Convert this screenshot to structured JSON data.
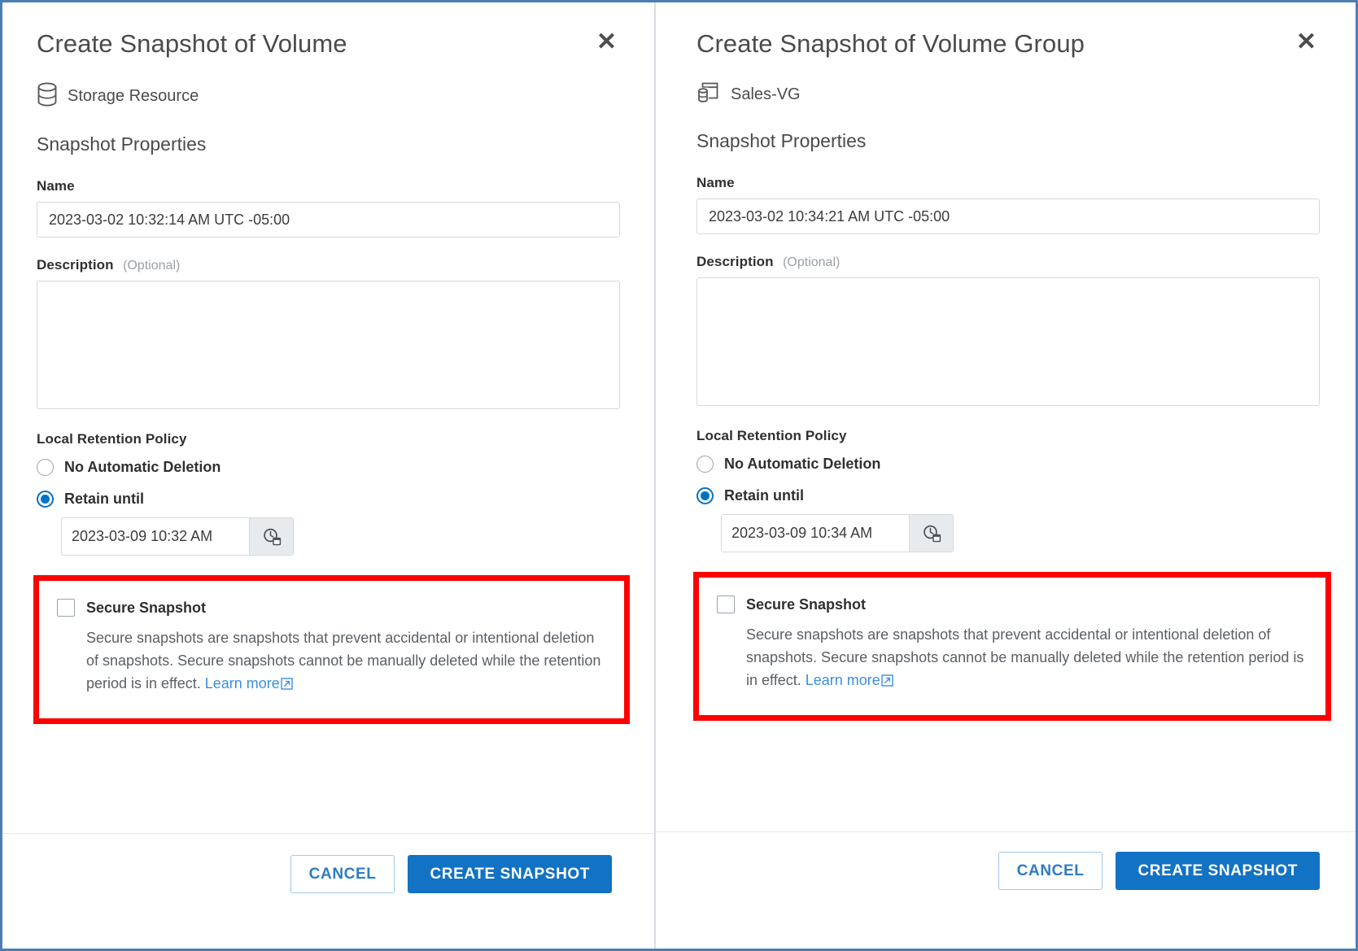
{
  "panels": [
    {
      "title": "Create Snapshot of Volume",
      "close_icon": "close-icon",
      "resource": {
        "icon": "storage-volume-icon",
        "name": "Storage Resource"
      },
      "section_title": "Snapshot Properties",
      "name_field": {
        "label": "Name",
        "value": "2023-03-02 10:32:14 AM UTC -05:00"
      },
      "description_field": {
        "label": "Description",
        "optional": "(Optional)",
        "value": "",
        "placeholder": ""
      },
      "retention": {
        "label": "Local Retention Policy",
        "options": [
          {
            "label": "No Automatic Deletion",
            "selected": false
          },
          {
            "label": "Retain until",
            "selected": true
          }
        ],
        "retain_until_value": "2023-03-09 10:32 AM",
        "picker_icon": "clock-calendar-picker-icon"
      },
      "secure_snapshot": {
        "checkbox_label": "Secure Snapshot",
        "checked": false,
        "help_text": "Secure snapshots are snapshots that prevent accidental or intentional deletion of snapshots. Secure snapshots cannot be manually deleted while the retention period is in effect. ",
        "link_text": "Learn more",
        "link_icon": "external-link-icon",
        "highlight_color": "#fe0000"
      },
      "footer": {
        "cancel_label": "CANCEL",
        "submit_label": "CREATE SNAPSHOT"
      }
    },
    {
      "title": "Create Snapshot of Volume Group",
      "close_icon": "close-icon",
      "resource": {
        "icon": "volume-group-icon",
        "name": "Sales-VG"
      },
      "section_title": "Snapshot Properties",
      "name_field": {
        "label": "Name",
        "value": "2023-03-02 10:34:21 AM UTC -05:00"
      },
      "description_field": {
        "label": "Description",
        "optional": "(Optional)",
        "value": "",
        "placeholder": ""
      },
      "retention": {
        "label": "Local Retention Policy",
        "options": [
          {
            "label": "No Automatic Deletion",
            "selected": false
          },
          {
            "label": "Retain until",
            "selected": true
          }
        ],
        "retain_until_value": "2023-03-09 10:34 AM",
        "picker_icon": "clock-calendar-picker-icon"
      },
      "secure_snapshot": {
        "checkbox_label": "Secure Snapshot",
        "checked": false,
        "help_text": "Secure snapshots are snapshots that prevent accidental or intentional deletion of snapshots. Secure snapshots cannot be manually deleted while the retention period is in effect. ",
        "link_text": "Learn more",
        "link_icon": "external-link-icon",
        "highlight_color": "#fe0000"
      },
      "footer": {
        "cancel_label": "CANCEL",
        "submit_label": "CREATE SNAPSHOT"
      }
    }
  ],
  "colors": {
    "accent_blue": "#1272c4",
    "link_blue": "#3c8ede",
    "highlight_red": "#fe0000",
    "border_frame": "#4a7fb5"
  }
}
